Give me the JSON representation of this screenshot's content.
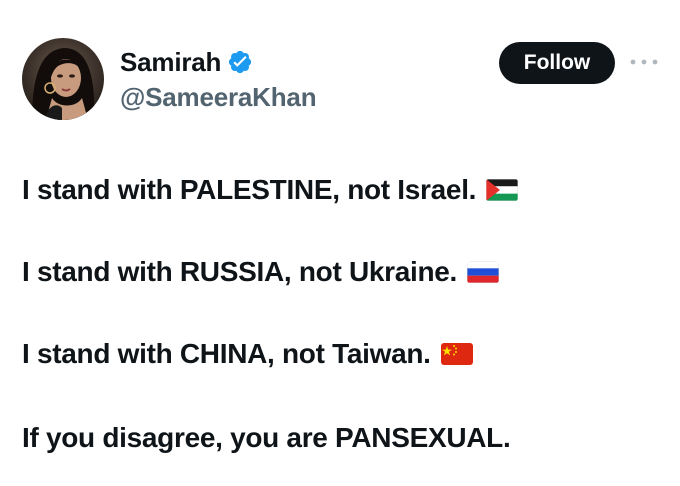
{
  "tweet": {
    "author": {
      "display_name": "Samirah",
      "handle": "@SameeraKhan",
      "verified": true,
      "verified_color": "#1d9bf0",
      "avatar_icon": "profile-photo"
    },
    "follow_label": "Follow",
    "more_icon": "more-dots-icon",
    "lines": [
      {
        "text": "I stand with PALESTINE, not Israel.",
        "flag": "palestine-flag-icon"
      },
      {
        "text": "I stand with RUSSIA, not Ukraine.",
        "flag": "russia-flag-icon"
      },
      {
        "text": "I stand with CHINA, not Taiwan.",
        "flag": "china-flag-icon"
      },
      {
        "text": "If you disagree, you are PANSEXUAL.",
        "flag": ""
      }
    ]
  },
  "colors": {
    "text": "#0f1419",
    "secondary_text": "#536471",
    "button_bg": "#0f1419",
    "button_text": "#ffffff"
  }
}
